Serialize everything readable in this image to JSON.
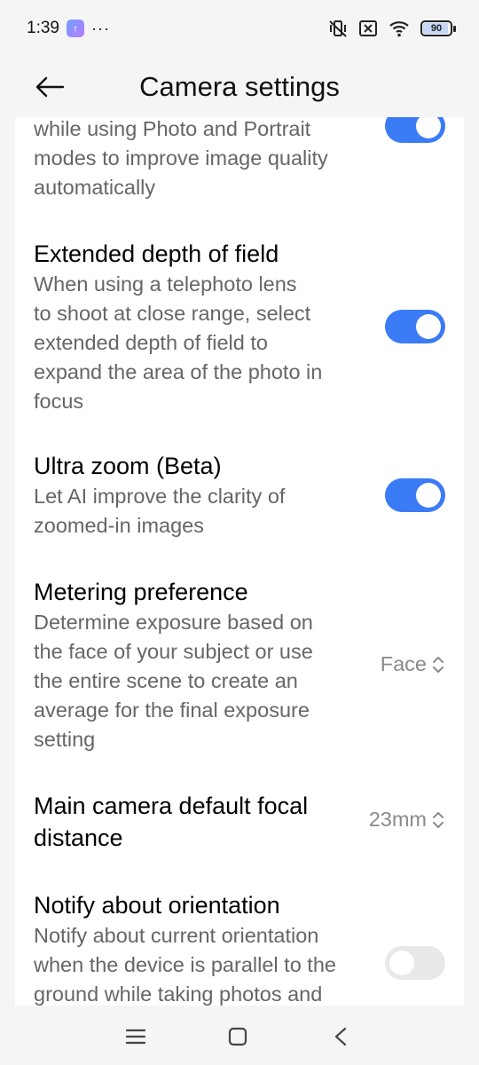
{
  "status_bar": {
    "time": "1:39",
    "more_indicator": "···",
    "battery_level": "90",
    "icons": [
      "app-notification-icon",
      "mute-vibrate-icon",
      "no-sim-icon",
      "wifi-icon",
      "battery-icon"
    ]
  },
  "header": {
    "title": "Camera settings",
    "back_icon": "arrow-left-icon"
  },
  "settings": [
    {
      "id": "partial-top",
      "lines": [
        "while using Photo and Portrait",
        "modes to improve image quality",
        "automatically"
      ],
      "control": "toggle",
      "value": true
    },
    {
      "id": "extended-depth",
      "title": "Extended depth of field",
      "lines": [
        "When using a telephoto lens",
        "to shoot at close range, select",
        "extended depth of field to",
        "expand the area of the photo in",
        "focus"
      ],
      "control": "toggle",
      "value": true
    },
    {
      "id": "ultra-zoom",
      "title": "Ultra zoom (Beta)",
      "lines": [
        "Let AI improve the clarity of",
        "zoomed-in images"
      ],
      "control": "toggle",
      "value": true
    },
    {
      "id": "metering",
      "title": "Metering preference",
      "lines": [
        "Determine exposure based on",
        "the face of your subject or use",
        "the entire scene to create an",
        "average for the final exposure",
        "setting"
      ],
      "control": "select",
      "value": "Face"
    },
    {
      "id": "focal-distance",
      "title_lines": [
        "Main camera default focal",
        "distance"
      ],
      "control": "select",
      "value": "23mm"
    },
    {
      "id": "orientation",
      "title": "Notify about orientation",
      "lines": [
        "Notify about current orientation",
        "when the device is parallel to the",
        "ground while taking photos and"
      ],
      "control": "toggle",
      "value": false
    }
  ],
  "colors": {
    "accent": "#3b7bf6",
    "toggle_off": "#e8e8e8",
    "secondary_text": "#666666",
    "value_text": "#8a8a8a",
    "background": "#f5f5f5"
  },
  "nav_bar": {
    "icons": [
      "menu-icon",
      "home-icon",
      "back-chevron-icon"
    ]
  }
}
